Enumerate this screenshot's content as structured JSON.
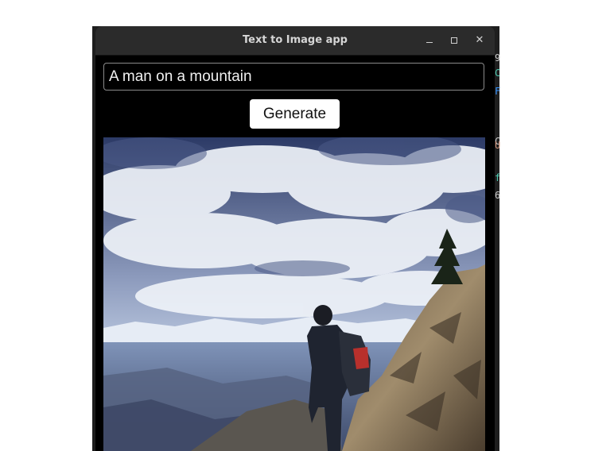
{
  "window": {
    "title": "Text to Image app",
    "controls": {
      "minimize": "minimize-icon",
      "maximize": "maximize-icon",
      "close": "close-icon"
    }
  },
  "prompt": {
    "value": "A man on a mountain"
  },
  "generate_button": {
    "label": "Generate"
  },
  "generated_image": {
    "subject": "hiker standing on a rocky mountain ridge under a cloudy sky"
  },
  "background_window": {
    "glyphs": [
      "9",
      "C",
      "F",
      "C",
      "U",
      "f",
      "6"
    ],
    "colors": [
      "#c8c8c8",
      "#4ec9b0",
      "#3794ff",
      "#c8c8c8",
      "#ce9178",
      "#4ec9b0",
      "#c8c8c8"
    ]
  },
  "colors": {
    "window_bg": "#000000",
    "titlebar": "#2b2b2b",
    "button_bg": "#ffffff"
  }
}
